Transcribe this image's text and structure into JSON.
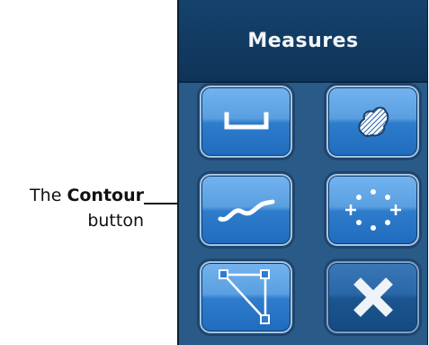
{
  "panel": {
    "title": "Measures"
  },
  "callout": {
    "prefix": "The",
    "bold": "Contour",
    "suffix": "button"
  },
  "tools": [
    {
      "name": "straight-line-measure",
      "icon": "ruler-bracket-icon"
    },
    {
      "name": "area-measure",
      "icon": "hatched-area-icon"
    },
    {
      "name": "contour-measure",
      "icon": "contour-curve-icon"
    },
    {
      "name": "point-measure",
      "icon": "dotted-circle-icon"
    },
    {
      "name": "polyline-measure",
      "icon": "polygon-vertices-icon"
    },
    {
      "name": "delete-measure",
      "icon": "close-x-icon"
    }
  ],
  "colors": {
    "panel_bg": "#2a5a87",
    "header_bg": "#0f3459",
    "button_light": "#73b3ef",
    "button_dark": "#1f6bbd"
  }
}
